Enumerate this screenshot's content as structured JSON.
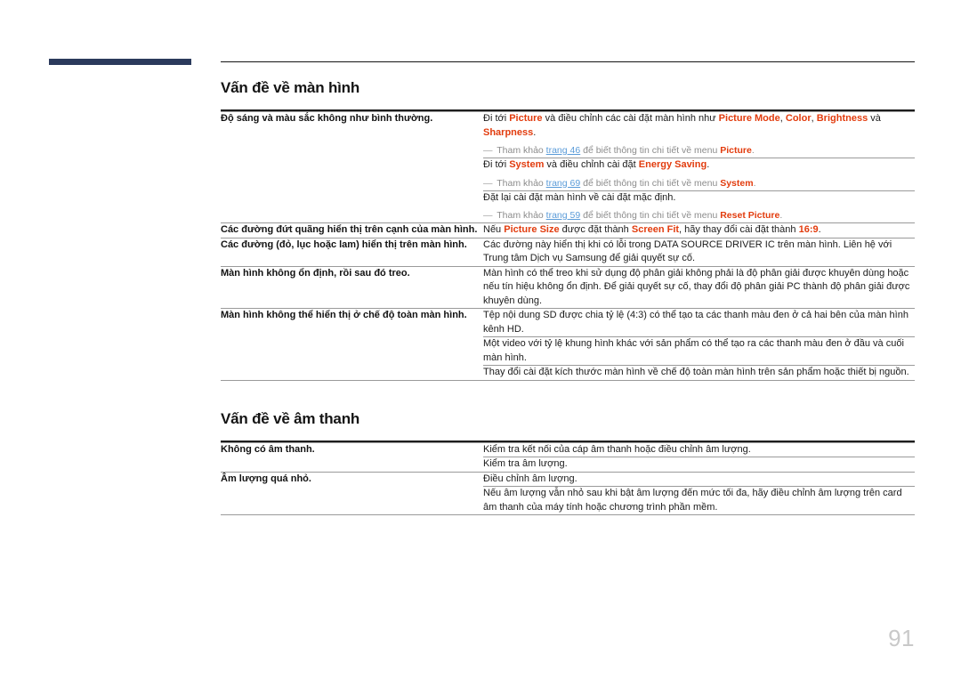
{
  "page": {
    "number": "91",
    "marker_color": "#2b3a5c",
    "accent_color": "#e23c0e",
    "link_color": "#5a9bd8",
    "note_color": "#8c8c8c"
  },
  "sections": [
    {
      "title": "Vấn đề về màn hình",
      "rows": [
        {
          "label": "Độ sáng và màu sắc không như bình thường.",
          "blocks": [
            {
              "lines": [
                {
                  "parts": [
                    {
                      "t": "Đi tới ",
                      "s": "plain"
                    },
                    {
                      "t": "Picture",
                      "s": "menu"
                    },
                    {
                      "t": " và điều chỉnh các cài đặt màn hình như ",
                      "s": "plain"
                    },
                    {
                      "t": "Picture Mode",
                      "s": "menu"
                    },
                    {
                      "t": ", ",
                      "s": "plain"
                    },
                    {
                      "t": "Color",
                      "s": "menu"
                    },
                    {
                      "t": ", ",
                      "s": "plain"
                    },
                    {
                      "t": "Brightness",
                      "s": "menu"
                    },
                    {
                      "t": " và ",
                      "s": "plain"
                    },
                    {
                      "t": "Sharpness",
                      "s": "menu"
                    },
                    {
                      "t": ".",
                      "s": "plain"
                    }
                  ]
                }
              ],
              "note": {
                "parts": [
                  {
                    "t": "―",
                    "s": "dash"
                  },
                  {
                    "t": " Tham khảo ",
                    "s": "plain"
                  },
                  {
                    "t": "trang 46",
                    "s": "link"
                  },
                  {
                    "t": " để biết thông tin chi tiết về menu ",
                    "s": "plain"
                  },
                  {
                    "t": "Picture",
                    "s": "menu"
                  },
                  {
                    "t": ".",
                    "s": "plain"
                  }
                ]
              }
            },
            {
              "lines": [
                {
                  "parts": [
                    {
                      "t": "Đi tới ",
                      "s": "plain"
                    },
                    {
                      "t": "System",
                      "s": "menu"
                    },
                    {
                      "t": " và điều chỉnh cài đặt ",
                      "s": "plain"
                    },
                    {
                      "t": "Energy Saving",
                      "s": "menu"
                    },
                    {
                      "t": ".",
                      "s": "plain"
                    }
                  ]
                }
              ],
              "note": {
                "parts": [
                  {
                    "t": "―",
                    "s": "dash"
                  },
                  {
                    "t": " Tham khảo ",
                    "s": "plain"
                  },
                  {
                    "t": "trang 69",
                    "s": "link"
                  },
                  {
                    "t": " để biết thông tin chi tiết về menu ",
                    "s": "plain"
                  },
                  {
                    "t": "System",
                    "s": "menu"
                  },
                  {
                    "t": ".",
                    "s": "plain"
                  }
                ]
              }
            },
            {
              "lines": [
                {
                  "parts": [
                    {
                      "t": "Đặt lại cài đặt màn hình về cài đặt mặc định.",
                      "s": "plain"
                    }
                  ]
                }
              ],
              "note": {
                "parts": [
                  {
                    "t": "―",
                    "s": "dash"
                  },
                  {
                    "t": " Tham khảo ",
                    "s": "plain"
                  },
                  {
                    "t": "trang 59",
                    "s": "link"
                  },
                  {
                    "t": " để biết thông tin chi tiết về menu ",
                    "s": "plain"
                  },
                  {
                    "t": "Reset Picture",
                    "s": "menu"
                  },
                  {
                    "t": ".",
                    "s": "plain"
                  }
                ]
              }
            }
          ]
        },
        {
          "label": "Các đường đứt quãng hiển thị trên cạnh của màn hình.",
          "blocks": [
            {
              "lines": [
                {
                  "parts": [
                    {
                      "t": "Nếu ",
                      "s": "plain"
                    },
                    {
                      "t": "Picture Size",
                      "s": "menu"
                    },
                    {
                      "t": " được đặt thành ",
                      "s": "plain"
                    },
                    {
                      "t": "Screen Fit",
                      "s": "menu"
                    },
                    {
                      "t": ", hãy thay đổi cài đặt thành ",
                      "s": "plain"
                    },
                    {
                      "t": "16:9",
                      "s": "menu"
                    },
                    {
                      "t": ".",
                      "s": "plain"
                    }
                  ]
                }
              ]
            }
          ]
        },
        {
          "label": "Các đường (đỏ, lục hoặc lam) hiển thị trên màn hình.",
          "blocks": [
            {
              "lines": [
                {
                  "parts": [
                    {
                      "t": "Các đường này hiển thị khi có lỗi trong DATA SOURCE DRIVER IC trên màn hình. Liên hệ với Trung tâm Dịch vụ Samsung để giải quyết sự cố.",
                      "s": "plain"
                    }
                  ]
                }
              ]
            }
          ]
        },
        {
          "label": "Màn hình không ổn định, rồi sau đó treo.",
          "blocks": [
            {
              "lines": [
                {
                  "parts": [
                    {
                      "t": "Màn hình có thể treo khi sử dụng độ phân giải không phải là độ phân giải được khuyên dùng hoặc nếu tín hiệu không ổn định. Để giải quyết sự cố, thay đổi độ phân giải PC thành độ phân giải được khuyên dùng.",
                      "s": "plain"
                    }
                  ]
                }
              ]
            }
          ]
        },
        {
          "label": "Màn hình không thể hiển thị ở chế độ toàn màn hình.",
          "blocks": [
            {
              "lines": [
                {
                  "parts": [
                    {
                      "t": "Tệp nội dung SD được chia tỷ lệ (4:3) có thể tạo ta các thanh màu đen ở cả hai bên của màn hình kênh HD.",
                      "s": "plain"
                    }
                  ]
                }
              ]
            },
            {
              "lines": [
                {
                  "parts": [
                    {
                      "t": "Một video với tỷ lệ khung hình khác với sản phẩm có thể tạo ra các thanh màu đen ở đầu và cuối màn hình.",
                      "s": "plain"
                    }
                  ]
                }
              ]
            },
            {
              "lines": [
                {
                  "parts": [
                    {
                      "t": "Thay đổi cài đặt kích thước màn hình về chế độ toàn màn hình trên sản phẩm hoặc thiết bị nguồn.",
                      "s": "plain"
                    }
                  ]
                }
              ]
            }
          ]
        }
      ]
    },
    {
      "title": "Vấn đề về âm thanh",
      "rows": [
        {
          "label": "Không có âm thanh.",
          "blocks": [
            {
              "lines": [
                {
                  "parts": [
                    {
                      "t": "Kiểm tra kết nối của cáp âm thanh hoặc điều chỉnh âm lượng.",
                      "s": "plain"
                    }
                  ]
                }
              ]
            },
            {
              "lines": [
                {
                  "parts": [
                    {
                      "t": "Kiểm tra âm lượng.",
                      "s": "plain"
                    }
                  ]
                }
              ]
            }
          ]
        },
        {
          "label": "Âm lượng quá nhỏ.",
          "blocks": [
            {
              "lines": [
                {
                  "parts": [
                    {
                      "t": "Điều chỉnh âm lượng.",
                      "s": "plain"
                    }
                  ]
                }
              ]
            },
            {
              "lines": [
                {
                  "parts": [
                    {
                      "t": "Nếu âm lượng vẫn nhỏ sau khi bật âm lượng đến mức tối đa, hãy điều chỉnh âm lượng trên card âm thanh của máy tính hoặc chương trình phần mềm.",
                      "s": "plain"
                    }
                  ]
                }
              ]
            }
          ]
        }
      ]
    }
  ]
}
